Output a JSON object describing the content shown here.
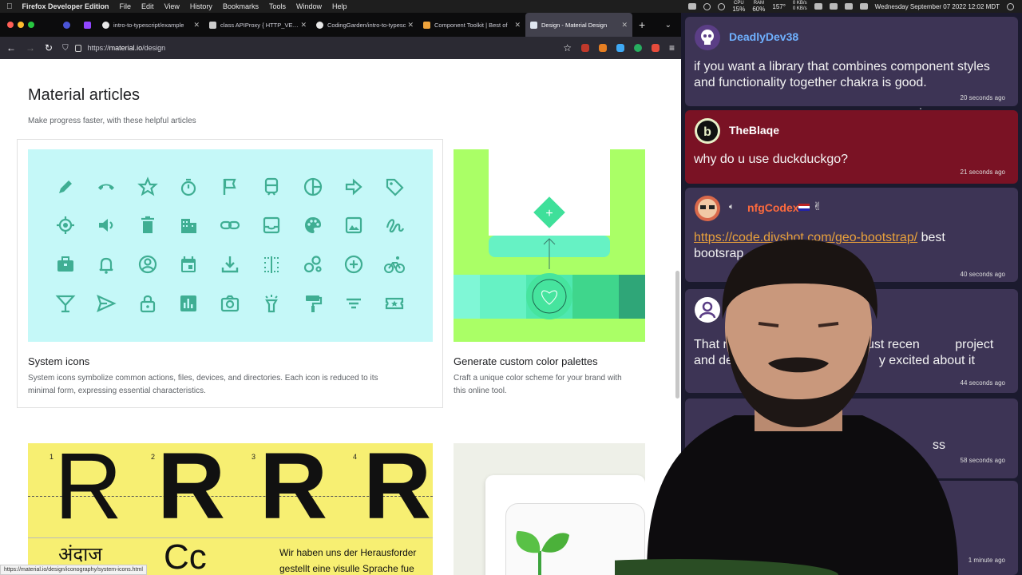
{
  "menubar": {
    "app": "Firefox Developer Edition",
    "items": [
      "File",
      "Edit",
      "View",
      "History",
      "Bookmarks",
      "Tools",
      "Window",
      "Help"
    ],
    "cpu_label": "CPU",
    "cpu": "15%",
    "ram_label": "RAM",
    "ram": "60%",
    "temp": "157°",
    "net_up": "0 KB/s",
    "net_down": "0 KB/s",
    "datetime": "Wednesday September 07 2022  12:02 MDT"
  },
  "tabs": [
    {
      "title": "intro-to-typescript/example",
      "color": "#e8e8e8"
    },
    {
      "title": "class APIProxy { HTTP_VERB",
      "color": "#cccccc"
    },
    {
      "title": "CodingGarden/intro-to-typesc",
      "color": "#e8e8e8"
    },
    {
      "title": "Component Toolkit | Best of",
      "color": "#f0a43c"
    },
    {
      "title": "Design - Material Design",
      "color": "#dfe6f0"
    }
  ],
  "nav": {
    "url_prefix": "https://",
    "url_host": "material.io",
    "url_path": "/design"
  },
  "page": {
    "section_title": "Material articles",
    "section_subtitle": "Make progress faster, with these helpful articles",
    "cards": [
      {
        "title": "System icons",
        "desc1": "System icons symbolize common actions, files, devices, and directories. Each icon is reduced to its",
        "desc2": "minimal form, expressing essential characteristics."
      },
      {
        "title": "Generate custom color palettes",
        "desc1": "Craft a unique color scheme for your brand with",
        "desc2": "this online tool."
      }
    ],
    "type_numbers": [
      "1",
      "2",
      "3",
      "4"
    ],
    "type_letter": "R",
    "type_devanagari": "अंदाज",
    "type_cc": "Cc",
    "type_german_1": "Wir haben uns der Herausforder",
    "type_german_2": "gestellt eine visulle Sprache fue",
    "status_url": "https://material.io/design/iconography/system-icons.html"
  },
  "icons": [
    "pencil-icon",
    "phone-hangup-icon",
    "star-icon",
    "timer-icon",
    "flag-icon",
    "train-icon",
    "pie-chart-icon",
    "arrow-right-icon",
    "tag-icon",
    "gps-icon",
    "volume-icon",
    "trash-icon",
    "building-icon",
    "link-icon",
    "inbox-icon",
    "palette-icon",
    "image-icon",
    "gesture-icon",
    "briefcase-icon",
    "bell-icon",
    "account-circle-icon",
    "calendar-icon",
    "download-icon",
    "grid-dots-icon",
    "bubbles-icon",
    "add-circle-icon",
    "bike-icon",
    "cocktail-icon",
    "send-icon",
    "lock-icon",
    "bar-chart-icon",
    "camera-icon",
    "flashlight-icon",
    "paint-roller-icon",
    "filter-icon",
    "ticket-icon"
  ],
  "chat": [
    {
      "user": "DeadlyDev38",
      "user_color": "#6fb1ff",
      "text": "if you want a library that combines component styles and functionality together chakra is good.",
      "time": "20 seconds ago"
    },
    {
      "user": "TheBlaqe",
      "user_color": "#ffffff",
      "text": "why do u use duckduckgo?",
      "time": "21 seconds ago"
    },
    {
      "user": "nfgCodex",
      "user_color": "#ff6a3d",
      "link": "https://code.divshot.com/geo-bootstrap/",
      "text_after": " best",
      "text_line2": "bootsrap",
      "time": "40 seconds ago"
    },
    {
      "user": "",
      "text": "That r       me in the past but I just recen          project and decided to use Tailwin          y excited about it",
      "time": "44 seconds ago"
    },
    {
      "user": "",
      "text": "ss",
      "time": "58 seconds ago"
    },
    {
      "user": "",
      "text": "",
      "time": "1 minute ago"
    }
  ],
  "colors": {
    "icon_teal": "#3fae93",
    "chat_bubble": "#3d3455",
    "chat_highlight": "#7a1224"
  }
}
